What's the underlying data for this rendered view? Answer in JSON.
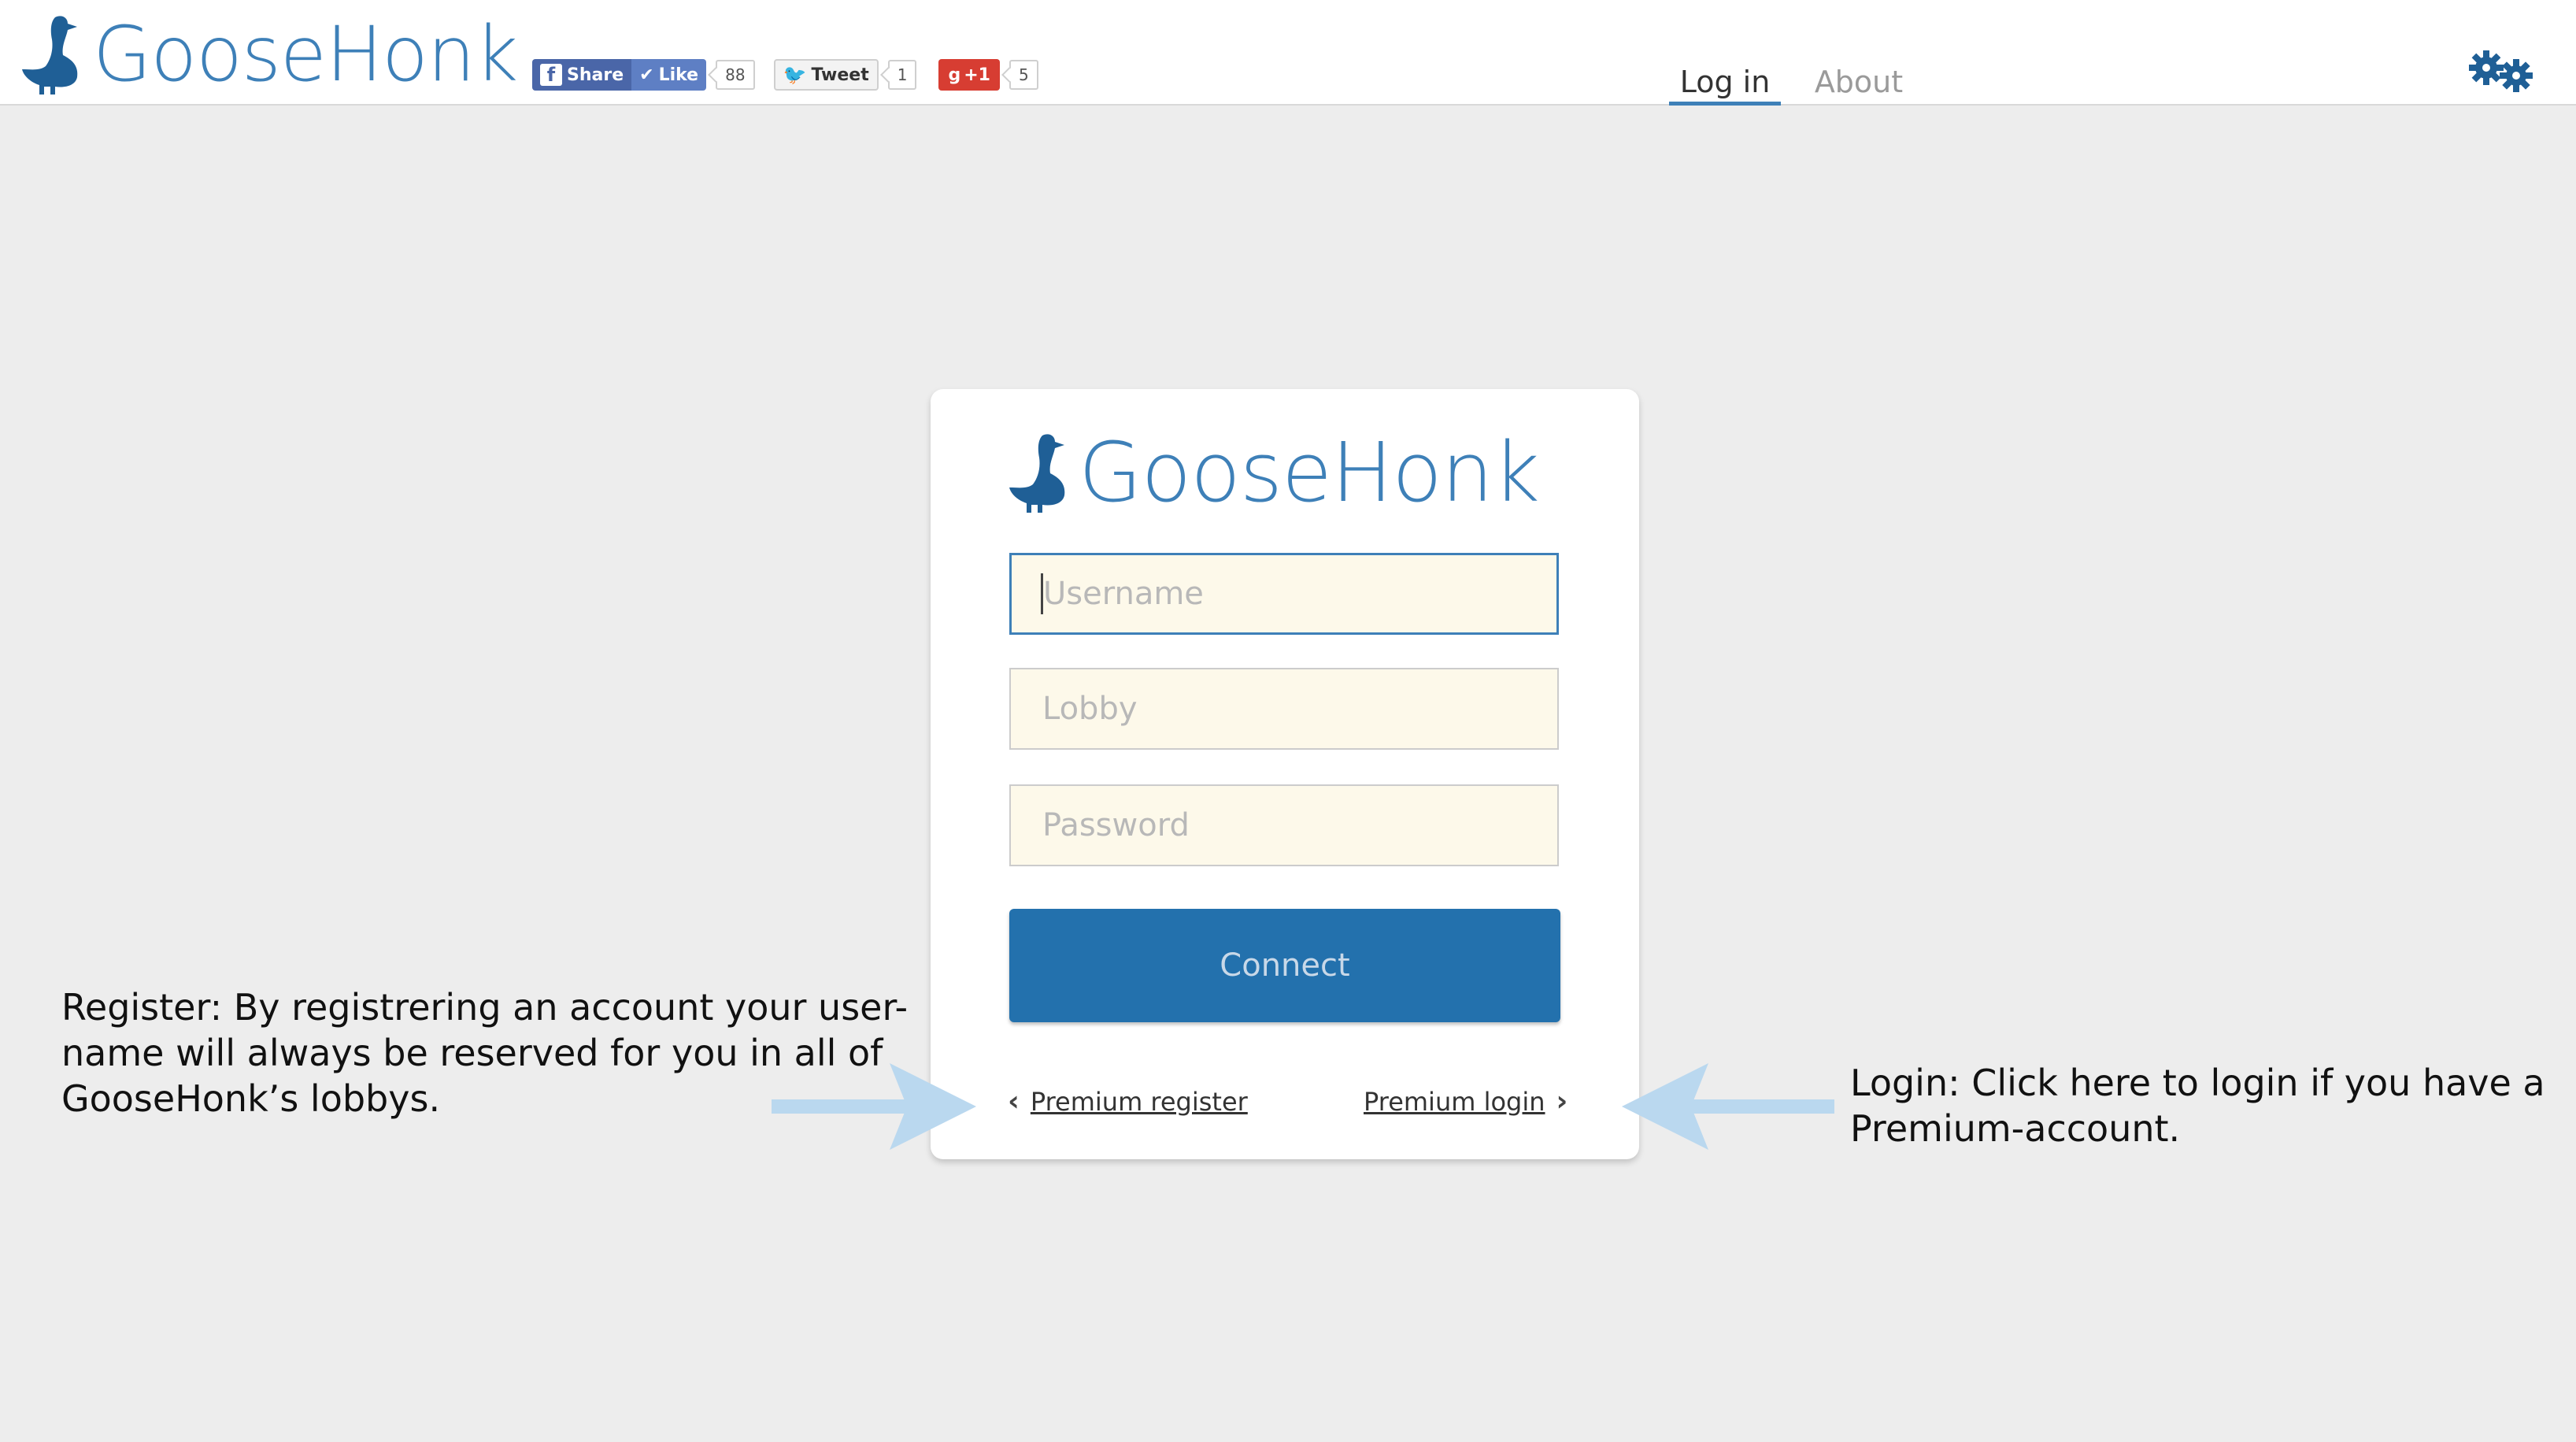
{
  "brand": {
    "name": "GooseHonk"
  },
  "social": {
    "fb_share": "Share",
    "fb_like": "Like",
    "fb_count": "88",
    "tweet": "Tweet",
    "tweet_count": "1",
    "gplus": "+1",
    "gplus_count": "5"
  },
  "nav": {
    "login": "Log in",
    "about": "About"
  },
  "form": {
    "username_placeholder": "Username",
    "lobby_placeholder": "Lobby",
    "password_placeholder": "Password",
    "connect_label": "Connect",
    "premium_register": "Premium register",
    "premium_login": "Premium login"
  },
  "annotations": {
    "register": "Register: By registrering an account your user-name will always be reserved for you in all of GooseHonk’s lobbys.",
    "login": "Login: Click here to login if you have a Premium-account."
  },
  "colors": {
    "brand_blue": "#3e80b8",
    "button_blue": "#2371ad",
    "field_bg": "#fdf9ea",
    "arrow_blue": "#bad8ef",
    "page_bg": "#ededed"
  },
  "icons": [
    "goose-logo-icon",
    "facebook-icon",
    "checkmark-icon",
    "twitter-bird-icon",
    "gears-icon",
    "chevron-left-icon",
    "chevron-right-icon",
    "arrow-right-icon",
    "arrow-left-icon"
  ]
}
